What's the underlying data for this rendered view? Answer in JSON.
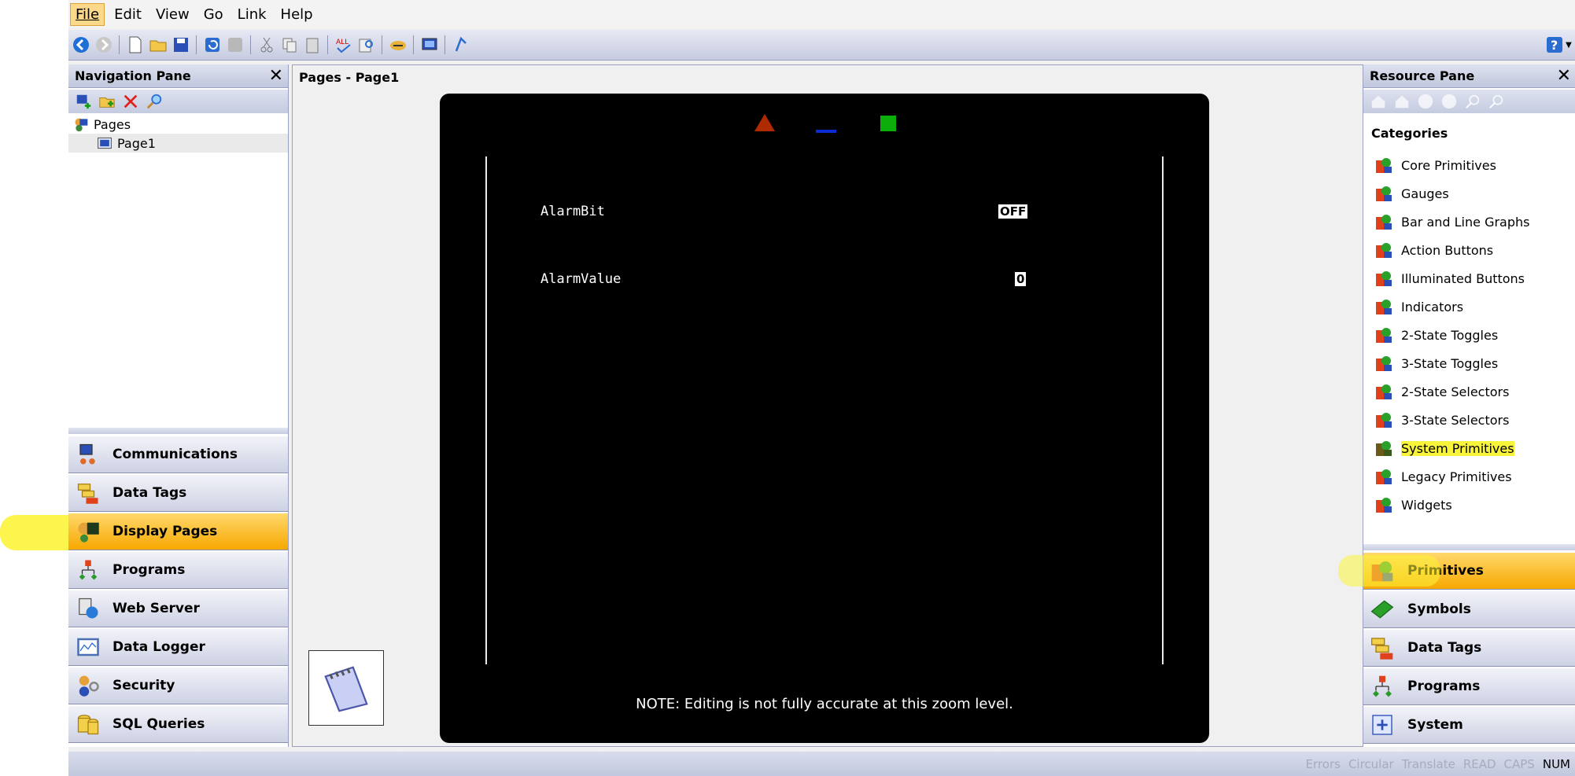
{
  "menu": [
    "File",
    "Edit",
    "View",
    "Go",
    "Link",
    "Help"
  ],
  "nav_pane": {
    "title": "Navigation Pane",
    "tree": {
      "root": "Pages",
      "child": "Page1"
    },
    "buttons": [
      "Communications",
      "Data Tags",
      "Display Pages",
      "Programs",
      "Web Server",
      "Data Logger",
      "Security",
      "SQL Queries"
    ],
    "active": "Display Pages"
  },
  "center": {
    "title": "Pages - Page1",
    "labels": {
      "alarm_bit": "AlarmBit",
      "alarm_value": "AlarmValue"
    },
    "values": {
      "alarm_bit": "OFF",
      "alarm_value": "0"
    },
    "note": "NOTE: Editing is not fully accurate at this zoom level."
  },
  "resource_pane": {
    "title": "Resource Pane",
    "categories_title": "Categories",
    "categories": [
      "Core Primitives",
      "Gauges",
      "Bar and Line Graphs",
      "Action Buttons",
      "Illuminated Buttons",
      "Indicators",
      "2-State Toggles",
      "3-State Toggles",
      "2-State Selectors",
      "3-State Selectors",
      "System Primitives",
      "Legacy Primitives",
      "Widgets"
    ],
    "highlighted_category": "System Primitives",
    "buttons": [
      "Primitives",
      "Symbols",
      "Data Tags",
      "Programs",
      "System"
    ],
    "active": "Primitives"
  },
  "status": [
    "Errors",
    "Circular",
    "Translate",
    "READ",
    "CAPS",
    "NUM"
  ],
  "colors": {
    "accent": "#f7a800",
    "highlight": "#f8f43c",
    "canvas": "#000000"
  }
}
